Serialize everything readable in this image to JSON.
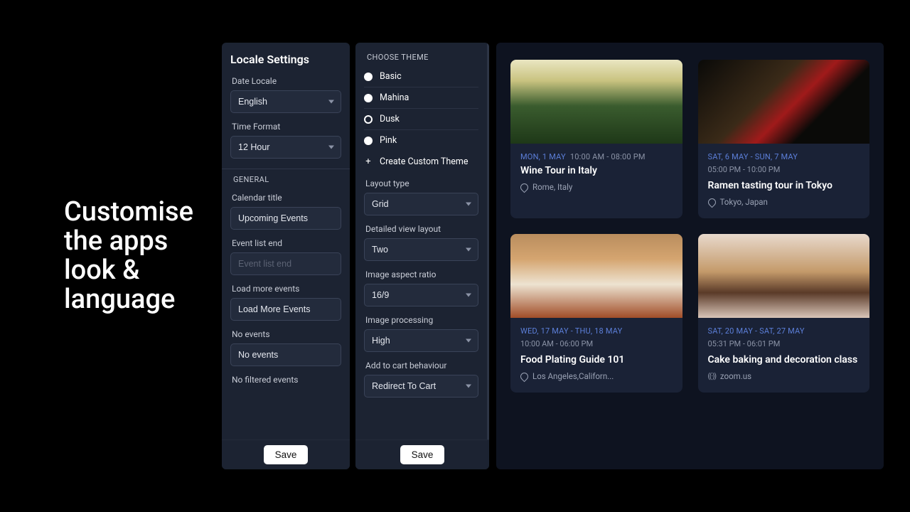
{
  "headline": "Customise the apps look & language",
  "locale_panel": {
    "title": "Locale Settings",
    "date_locale_label": "Date Locale",
    "date_locale_value": "English",
    "time_format_label": "Time Format",
    "time_format_value": "12 Hour",
    "general_section": "GENERAL",
    "calendar_title_label": "Calendar title",
    "calendar_title_value": "Upcoming Events",
    "event_list_end_label": "Event list end",
    "event_list_end_placeholder": "Event list end",
    "load_more_label": "Load more events",
    "load_more_value": "Load More Events",
    "no_events_label": "No events",
    "no_events_value": "No events",
    "no_filtered_label": "No filtered events",
    "save": "Save"
  },
  "theme_panel": {
    "choose_theme": "CHOOSE THEME",
    "themes": [
      {
        "label": "Basic",
        "selected": false
      },
      {
        "label": "Mahina",
        "selected": false
      },
      {
        "label": "Dusk",
        "selected": true
      },
      {
        "label": "Pink",
        "selected": false
      }
    ],
    "create_custom": "Create Custom Theme",
    "layout_type_label": "Layout type",
    "layout_type_value": "Grid",
    "detailed_view_label": "Detailed view layout",
    "detailed_view_value": "Two",
    "aspect_ratio_label": "Image aspect ratio",
    "aspect_ratio_value": "16/9",
    "image_processing_label": "Image processing",
    "image_processing_value": "High",
    "add_to_cart_label": "Add to cart behaviour",
    "add_to_cart_value": "Redirect To Cart",
    "save": "Save"
  },
  "preview": {
    "cards": [
      {
        "date": "MON, 1 MAY",
        "time": "10:00 AM - 08:00 PM",
        "title": "Wine Tour in Italy",
        "location": "Rome, Italy",
        "inline_time": true,
        "online": false
      },
      {
        "date": "SAT, 6 MAY - SUN, 7 MAY",
        "time": "05:00 PM - 10:00 PM",
        "title": "Ramen tasting tour in Tokyo",
        "location": "Tokyo, Japan",
        "inline_time": false,
        "online": false
      },
      {
        "date": "WED, 17 MAY - THU, 18 MAY",
        "time": "10:00 AM - 06:00 PM",
        "title": "Food Plating Guide 101",
        "location": "Los Angeles,Californ...",
        "inline_time": false,
        "online": false
      },
      {
        "date": "SAT, 20 MAY - SAT, 27 MAY",
        "time": "05:31 PM - 06:01 PM",
        "title": "Cake baking and decoration class",
        "location": "zoom.us",
        "inline_time": false,
        "online": true
      }
    ]
  }
}
